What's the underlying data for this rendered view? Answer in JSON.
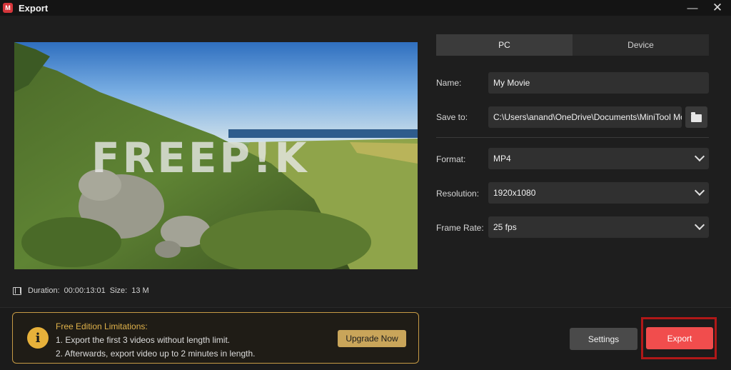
{
  "window": {
    "title": "Export",
    "minimize_glyph": "—",
    "close_glyph": "✕",
    "app_icon_glyph": "M"
  },
  "preview": {
    "watermark": "FREEP!K",
    "duration_label": "Duration:",
    "duration_value": "00:00:13:01",
    "size_label": "Size:",
    "size_value": "13 M"
  },
  "tabs": [
    {
      "label": "PC",
      "active": true
    },
    {
      "label": "Device",
      "active": false
    }
  ],
  "form": {
    "name_label": "Name:",
    "name_value": "My Movie",
    "save_to_label": "Save to:",
    "save_to_value": "C:\\Users\\anand\\OneDrive\\Documents\\MiniTool Mo",
    "format_label": "Format:",
    "format_value": "MP4",
    "resolution_label": "Resolution:",
    "resolution_value": "1920x1080",
    "frame_rate_label": "Frame Rate:",
    "frame_rate_value": "25 fps"
  },
  "limitations": {
    "title": "Free Edition Limitations:",
    "line1": "1. Export the first 3 videos without length limit.",
    "line2": "2. Afterwards, export video up to 2 minutes in length.",
    "upgrade_label": "Upgrade Now",
    "info_glyph": "i"
  },
  "actions": {
    "settings_label": "Settings",
    "export_label": "Export"
  },
  "colors": {
    "accent_red": "#f14d4d",
    "highlight_border": "#b01818",
    "limit_gold": "#c79b45"
  }
}
